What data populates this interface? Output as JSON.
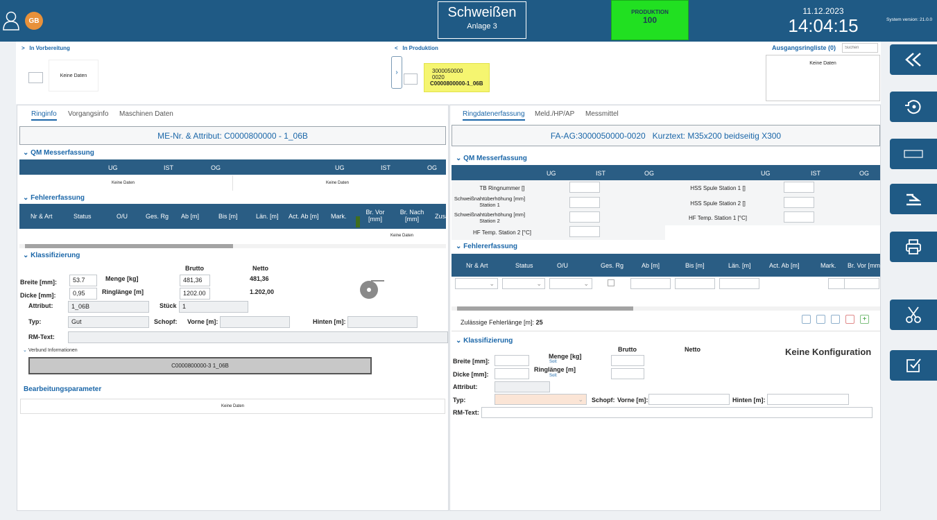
{
  "header": {
    "avatar_initials": "GB",
    "station_title": "Schweißen",
    "station_subtitle": "Anlage 3",
    "status_label": "PRODUKTION",
    "status_value": "100",
    "date": "11.12.2023",
    "time": "14:04:15",
    "version": "System version: 21.0.0",
    "status_color": "#21e021"
  },
  "queue": {
    "prep_label": "In Vorbereitung",
    "prep_empty": "Keine Daten",
    "prod_label": "In Produktion",
    "card_line1": "3000050000",
    "card_line2": "0020",
    "card_line3": "C0000800000-1_06B",
    "out_label": "Ausgangsringliste (0)",
    "search_placeholder": "Suchen",
    "out_empty": "Keine Daten"
  },
  "left": {
    "tabs": [
      "Ringinfo",
      "Vorgangsinfo",
      "Maschinen Daten"
    ],
    "banner": "ME-Nr. & Attribut: C0000800000 - 1_06B",
    "qm_title": "QM Messerfassung",
    "qm_cols": [
      "UG",
      "IST",
      "OG",
      "UG",
      "IST",
      "OG"
    ],
    "qm_empty1": "Keine Daten",
    "qm_empty2": "Keine Daten",
    "fe_title": "Fehlererfassung",
    "fe_cols": [
      "Nr & Art",
      "Status",
      "O/U",
      "Ges. Rg",
      "Ab [m]",
      "Bis [m]",
      "Län. [m]",
      "Act. Ab [m]",
      "Mark.",
      "Br. Vor [mm]",
      "Br. Nach [mm]",
      "Zusa"
    ],
    "fe_empty": "Keine Daten",
    "kl_title": "Klassifizierung",
    "brutto": "Brutto",
    "netto": "Netto",
    "breite_lbl": "Breite [mm]:",
    "breite_val": "53.7",
    "dicke_lbl": "Dicke [mm]:",
    "dicke_val": "0,95",
    "attribut_lbl": "Attribut:",
    "attribut_val": "1_06B",
    "menge_lbl": "Menge [kg]",
    "menge_brutto": "481,36",
    "menge_netto": "481,36",
    "ringl_lbl": "Ringlänge [m]",
    "ringl_brutto": "1202.00",
    "ringl_netto": "1.202,00",
    "stueck_lbl": "Stück",
    "stueck_val": "1",
    "typ_lbl": "Typ:",
    "typ_val": "Gut",
    "schopf_lbl": "Schopf:",
    "vorne_lbl": "Vorne [m]:",
    "hinten_lbl": "Hinten [m]:",
    "rm_lbl": "RM-Text:",
    "verbund_title": "Verbund Informationen",
    "verbund_val": "C0000800000-3 1_06B",
    "bp_title": "Bearbeitungsparameter",
    "bp_empty": "Keine Daten"
  },
  "right": {
    "tabs": [
      "Ringdatenerfassung",
      "Meld./HP/AP",
      "Messmittel"
    ],
    "banner": "FA-AG:3000050000-0020   Kurztext: M35x200 beidseitig X300",
    "qm_title": "QM Messerfassung",
    "qm_cols": [
      "UG",
      "IST",
      "OG",
      "UG",
      "IST",
      "OG"
    ],
    "qm_rows_left": [
      "TB Ringnummer []",
      "Schweißnahtüberhöhung [mm] Station 1",
      "Schweißnahtüberhöhung [mm] Station 2",
      "HF Temp. Station 2 [°C]"
    ],
    "qm_rows_right": [
      "HSS Spule Station 1 []",
      "HSS Spule Station 2 []",
      "HF Temp. Station 1 [°C]"
    ],
    "fe_title": "Fehlererfassung",
    "fe_cols": [
      "Nr & Art",
      "Status",
      "O/U",
      "Ges. Rg",
      "Ab [m]",
      "Bis [m]",
      "Län. [m]",
      "Act. Ab [m]",
      "Mark.",
      "Br. Vor [mm"
    ],
    "allowed_lbl": "Zulässige Fehlerlänge [m]:",
    "allowed_val": "25",
    "kl_title": "Klassifizierung",
    "brutto": "Brutto",
    "netto": "Netto",
    "no_config": "Keine Konfiguration",
    "breite_lbl": "Breite [mm]:",
    "dicke_lbl": "Dicke [mm]:",
    "attribut_lbl": "Attribut:",
    "menge_lbl": "Menge [kg]",
    "soll1": "Soll:",
    "ringl_lbl": "Ringlänge [m]",
    "soll2": "Soll:",
    "typ_lbl": "Typ:",
    "schopf_lbl": "Schopf:",
    "vorne_lbl": "Vorne [m]:",
    "hinten_lbl": "Hinten [m]:",
    "rm_lbl": "RM-Text:"
  },
  "rail": [
    "rewind-icon",
    "reset-icon",
    "window-icon",
    "ramp-icon",
    "printer-icon",
    "scissors-icon",
    "checkbox-icon"
  ]
}
